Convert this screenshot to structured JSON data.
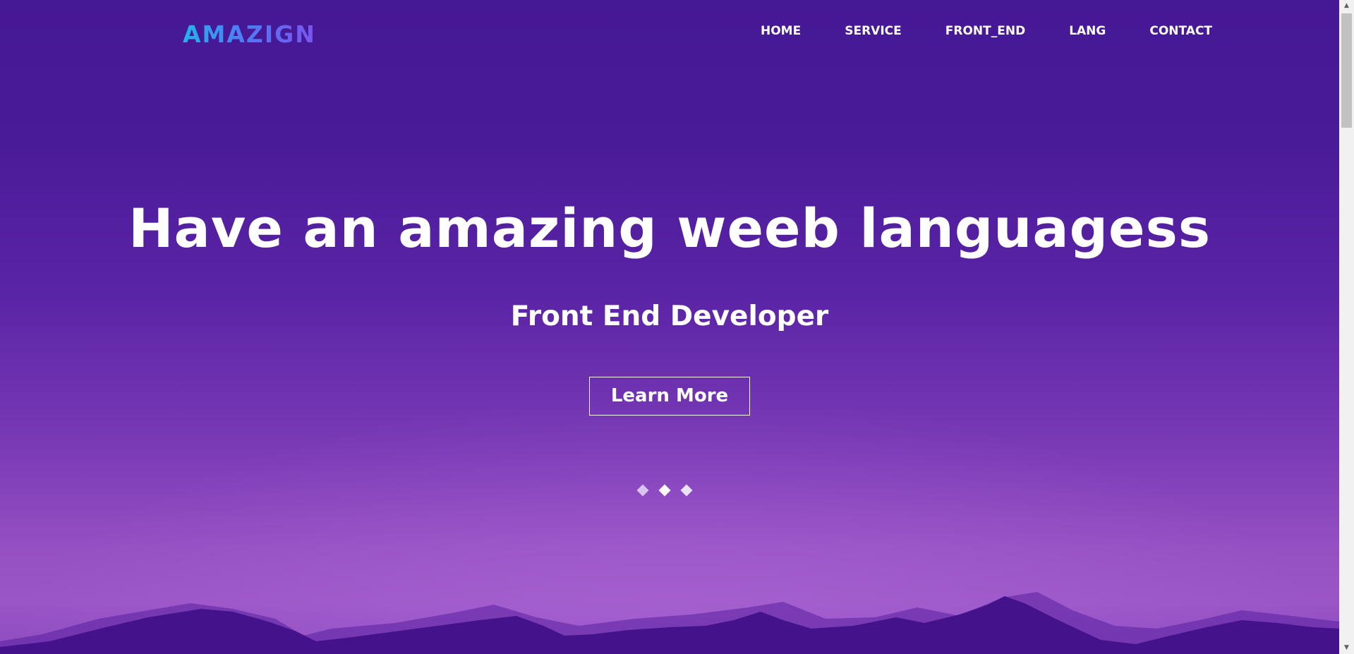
{
  "brand": {
    "logo_text": "AMAZIGN",
    "logo_colors": [
      "#23b3ee",
      "#7a54f0"
    ]
  },
  "nav": {
    "items": [
      {
        "label": "HOME"
      },
      {
        "label": "SERVICE"
      },
      {
        "label": "FRONT_END"
      },
      {
        "label": "LANG"
      },
      {
        "label": "CONTACT"
      }
    ]
  },
  "hero": {
    "title": "Have an amazing weeb languagess",
    "subtitle": "Front End Developer",
    "cta_label": "Learn More",
    "slider_dots": 3,
    "active_dot": 2,
    "background_top": "#451895",
    "background_bottom": "#9a55c6",
    "mountain_color": "#44138c"
  },
  "scrollbar": {
    "up_icon": "triangle-up-icon",
    "down_icon": "triangle-down-icon"
  }
}
